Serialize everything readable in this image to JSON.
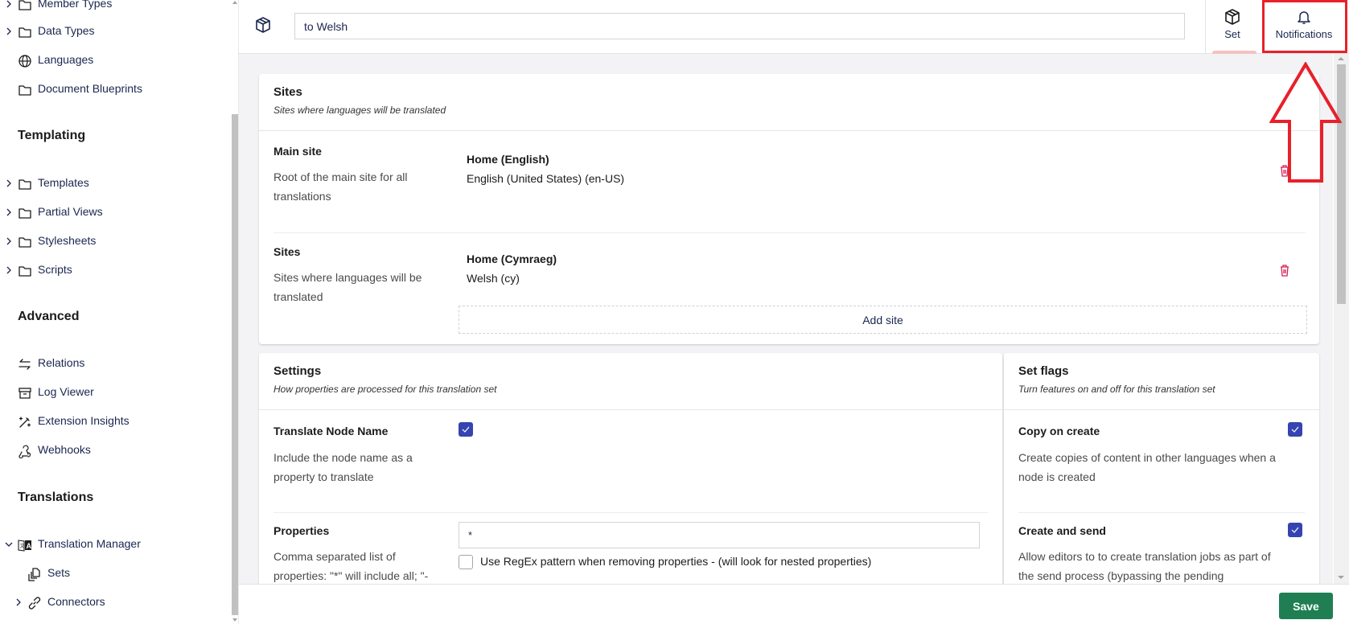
{
  "sidebar": {
    "items_top": [
      {
        "label": "Member Types",
        "icon": "folder-icon",
        "expandable": true
      },
      {
        "label": "Data Types",
        "icon": "folder-icon",
        "expandable": true
      },
      {
        "label": "Languages",
        "icon": "globe-icon",
        "expandable": false
      },
      {
        "label": "Document Blueprints",
        "icon": "folder-icon",
        "expandable": false
      }
    ],
    "templating": {
      "heading": "Templating",
      "items": [
        {
          "label": "Templates",
          "icon": "folder-icon"
        },
        {
          "label": "Partial Views",
          "icon": "folder-icon"
        },
        {
          "label": "Stylesheets",
          "icon": "folder-icon"
        },
        {
          "label": "Scripts",
          "icon": "folder-icon"
        }
      ]
    },
    "advanced": {
      "heading": "Advanced",
      "items": [
        {
          "label": "Relations",
          "icon": "arrows-left-right-icon"
        },
        {
          "label": "Log Viewer",
          "icon": "archive-icon"
        },
        {
          "label": "Extension Insights",
          "icon": "magic-wand-icon"
        },
        {
          "label": "Webhooks",
          "icon": "webhook-icon"
        }
      ]
    },
    "translations": {
      "heading": "Translations",
      "items": [
        {
          "label": "Translation Manager",
          "icon": "translate-icon",
          "expanded": true
        },
        {
          "label": "Sets",
          "icon": "copy-icon"
        },
        {
          "label": "Connectors",
          "icon": "link-icon"
        }
      ]
    }
  },
  "header": {
    "icon": "package-icon",
    "name_value": "to Welsh",
    "apps": [
      {
        "label": "Set",
        "icon": "package-icon",
        "active": true
      },
      {
        "label": "Notifications",
        "icon": "bell-icon",
        "active": false
      }
    ]
  },
  "sites_card": {
    "title": "Sites",
    "subtitle": "Sites where languages will be translated",
    "main_site": {
      "label": "Main site",
      "description": "Root of the main site for all translations",
      "site_name": "Home (English)",
      "site_language": "English (United States) (en-US)"
    },
    "sites": {
      "label": "Sites",
      "description": "Sites where languages will be translated",
      "entries": [
        {
          "site_name": "Home (Cymraeg)",
          "site_language": "Welsh (cy)"
        }
      ],
      "add_label": "Add site"
    }
  },
  "settings_card": {
    "title": "Settings",
    "subtitle": "How properties are processed for this translation set",
    "translate_node_name": {
      "label": "Translate Node Name",
      "description": "Include the node name as a property to translate",
      "checked": true
    },
    "properties": {
      "label": "Properties",
      "description": "Comma separated list of properties: \"*\" will include all; \"-",
      "value": "*",
      "regex_label": "Use RegEx pattern when removing properties - (will look for nested properties)",
      "regex_checked": false
    }
  },
  "flags_card": {
    "title": "Set flags",
    "subtitle": "Turn features on and off for this translation set",
    "copy_on_create": {
      "label": "Copy on create",
      "description": "Create copies of content in other languages when a node is created",
      "checked": true
    },
    "create_and_send": {
      "label": "Create and send",
      "description": "Allow editors to to create translation jobs as part of the send process (bypassing the pending",
      "checked": true
    }
  },
  "footer": {
    "save_label": "Save"
  },
  "colors": {
    "accent": "#3544b1",
    "save": "#1f7f53",
    "danger": "#d42054",
    "annotation": "#e8202a"
  }
}
